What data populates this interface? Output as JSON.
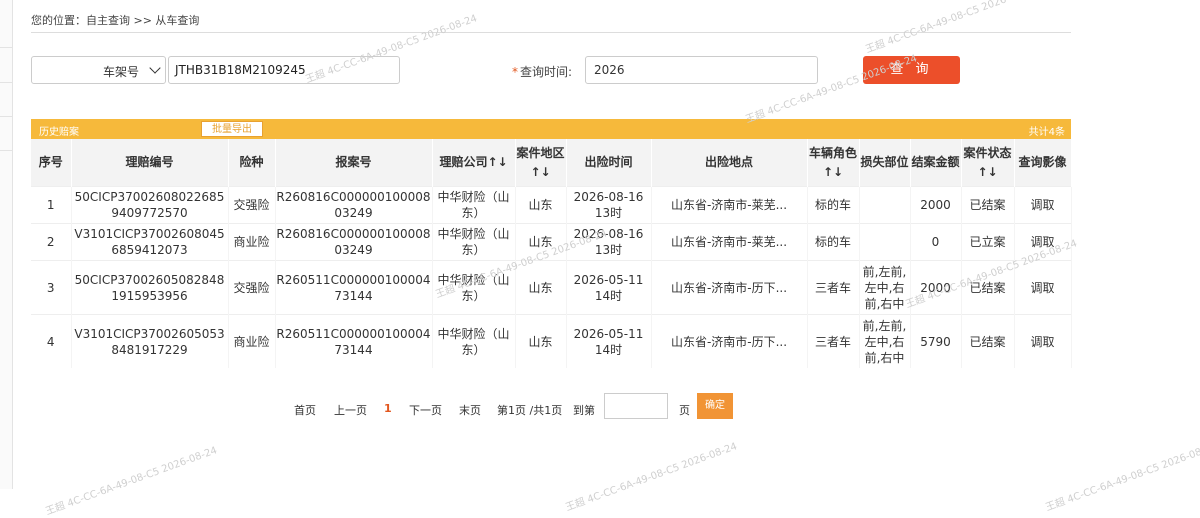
{
  "breadcrumb": "您的位置：自主查询 >> 从车查询",
  "search": {
    "field_type_value": "车架号",
    "vin_value": "JTHB31B18M2109245",
    "time_label": "查询时间:",
    "time_required_mark": "*",
    "time_value": "2026",
    "query_button": "查 询"
  },
  "table": {
    "section_title": "历史赔案",
    "export_button": "批量导出",
    "count_text": "共计4条",
    "columns": [
      "序号",
      "理赔编号",
      "险种",
      "报案号",
      "理赔公司↑↓",
      "案件地区↑↓",
      "出险时间",
      "出险地点",
      "车辆角色↑↓",
      "损失部位",
      "结案金额",
      "案件状态↑↓",
      "查询影像"
    ],
    "rows": [
      [
        "1",
        "50CICP370026080226859409772570",
        "交强险",
        "R260816C00000010000803249",
        "中华财险（山东）",
        "山东",
        "2026-08-16 13时",
        "山东省-济南市-莱芜...",
        "标的车",
        "",
        "2000",
        "已结案",
        "调取"
      ],
      [
        "2",
        "V3101CICP370026080456859412073",
        "商业险",
        "R260816C00000010000803249",
        "中华财险（山东）",
        "山东",
        "2026-08-16 13时",
        "山东省-济南市-莱芜...",
        "标的车",
        "",
        "0",
        "已立案",
        "调取"
      ],
      [
        "3",
        "50CICP370026050828481915953956",
        "交强险",
        "R260511C00000010000473144",
        "中华财险（山东）",
        "山东",
        "2026-05-11 14时",
        "山东省-济南市-历下...",
        "三者车",
        "前,左前,左中,右前,右中",
        "2000",
        "已结案",
        "调取"
      ],
      [
        "4",
        "V3101CICP370026050538481917229",
        "商业险",
        "R260511C00000010000473144",
        "中华财险（山东）",
        "山东",
        "2026-05-11 14时",
        "山东省-济南市-历下...",
        "三者车",
        "前,左前,左中,右前,右中",
        "5790",
        "已结案",
        "调取"
      ]
    ]
  },
  "pager": {
    "first": "首页",
    "prev": "上一页",
    "current": "1",
    "next": "下一页",
    "last": "末页",
    "info": "第1页 /共1页",
    "goto_label": "到第",
    "page_unit": "页",
    "go_button": "确定"
  },
  "watermarks": [
    "王超 4C-CC-6A-49-08-C5 2026-08-24"
  ],
  "colors": {
    "accent": "#ec4f2a",
    "table_bar": "#f6b93b",
    "go_button": "#f19435"
  }
}
